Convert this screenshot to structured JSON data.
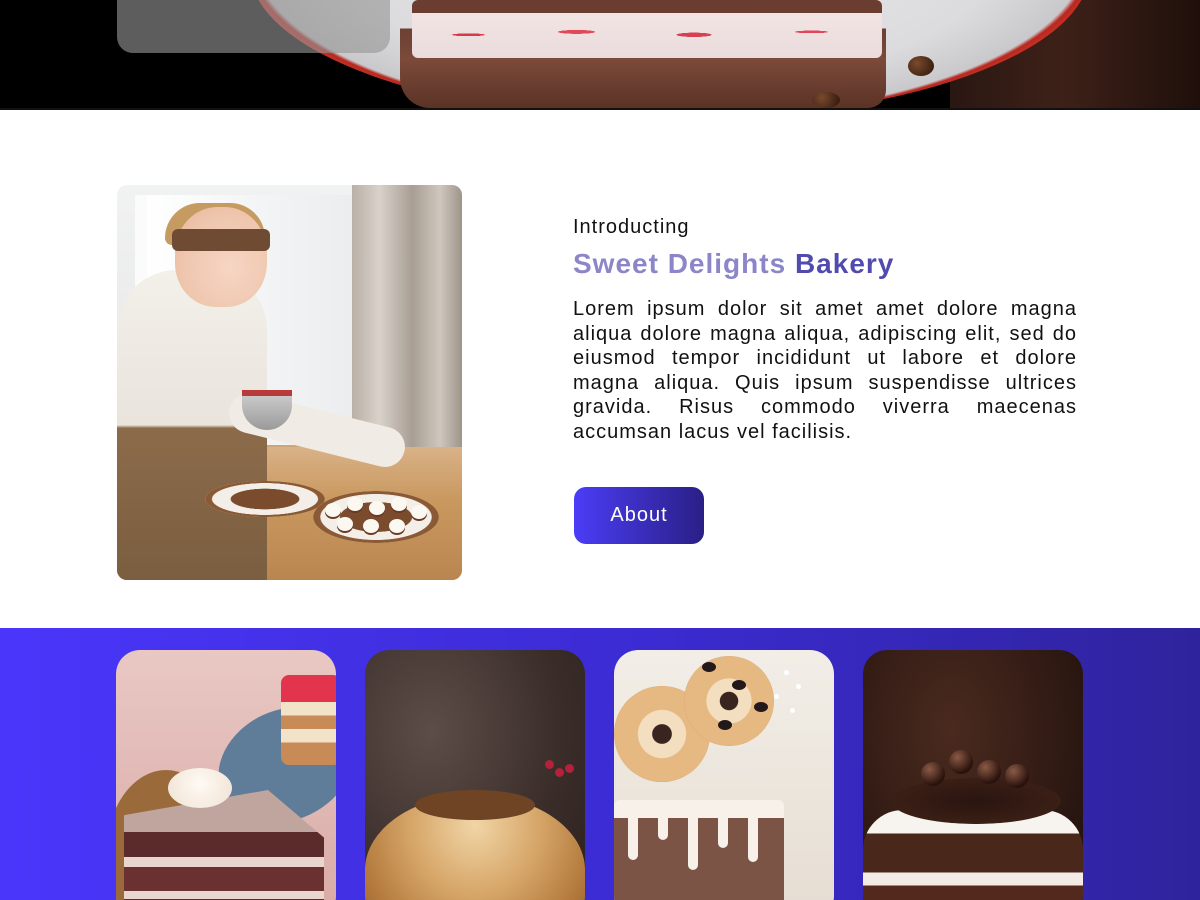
{
  "intro": {
    "kicker": "Introducting",
    "title_part1": "Sweet Delights",
    "title_part2": "Bakery",
    "body": "Lorem ipsum dolor sit amet amet dolore magna aliqua dolore magna aliqua, adipiscing elit, sed do eiusmod tempor incididunt ut labore et dolore magna aliqua. Quis ipsum suspendisse ultrices gravida. Risus commodo viverra maecenas accumsan lacus vel facilisis.",
    "about_button": "About"
  },
  "colors": {
    "title_light": "#8b86c9",
    "title_dark": "#514bb0",
    "button_start": "#4b3df6",
    "button_end": "#2a1f86",
    "products_band_start": "#4a36fb",
    "products_band_end": "#2f239c"
  },
  "products": {
    "items": [
      {
        "icon": "layered-cake-slice-photo"
      },
      {
        "icon": "glazed-bundt-cake-photo"
      },
      {
        "icon": "donut-drip-cake-photo"
      },
      {
        "icon": "black-forest-cake-photo"
      }
    ]
  }
}
